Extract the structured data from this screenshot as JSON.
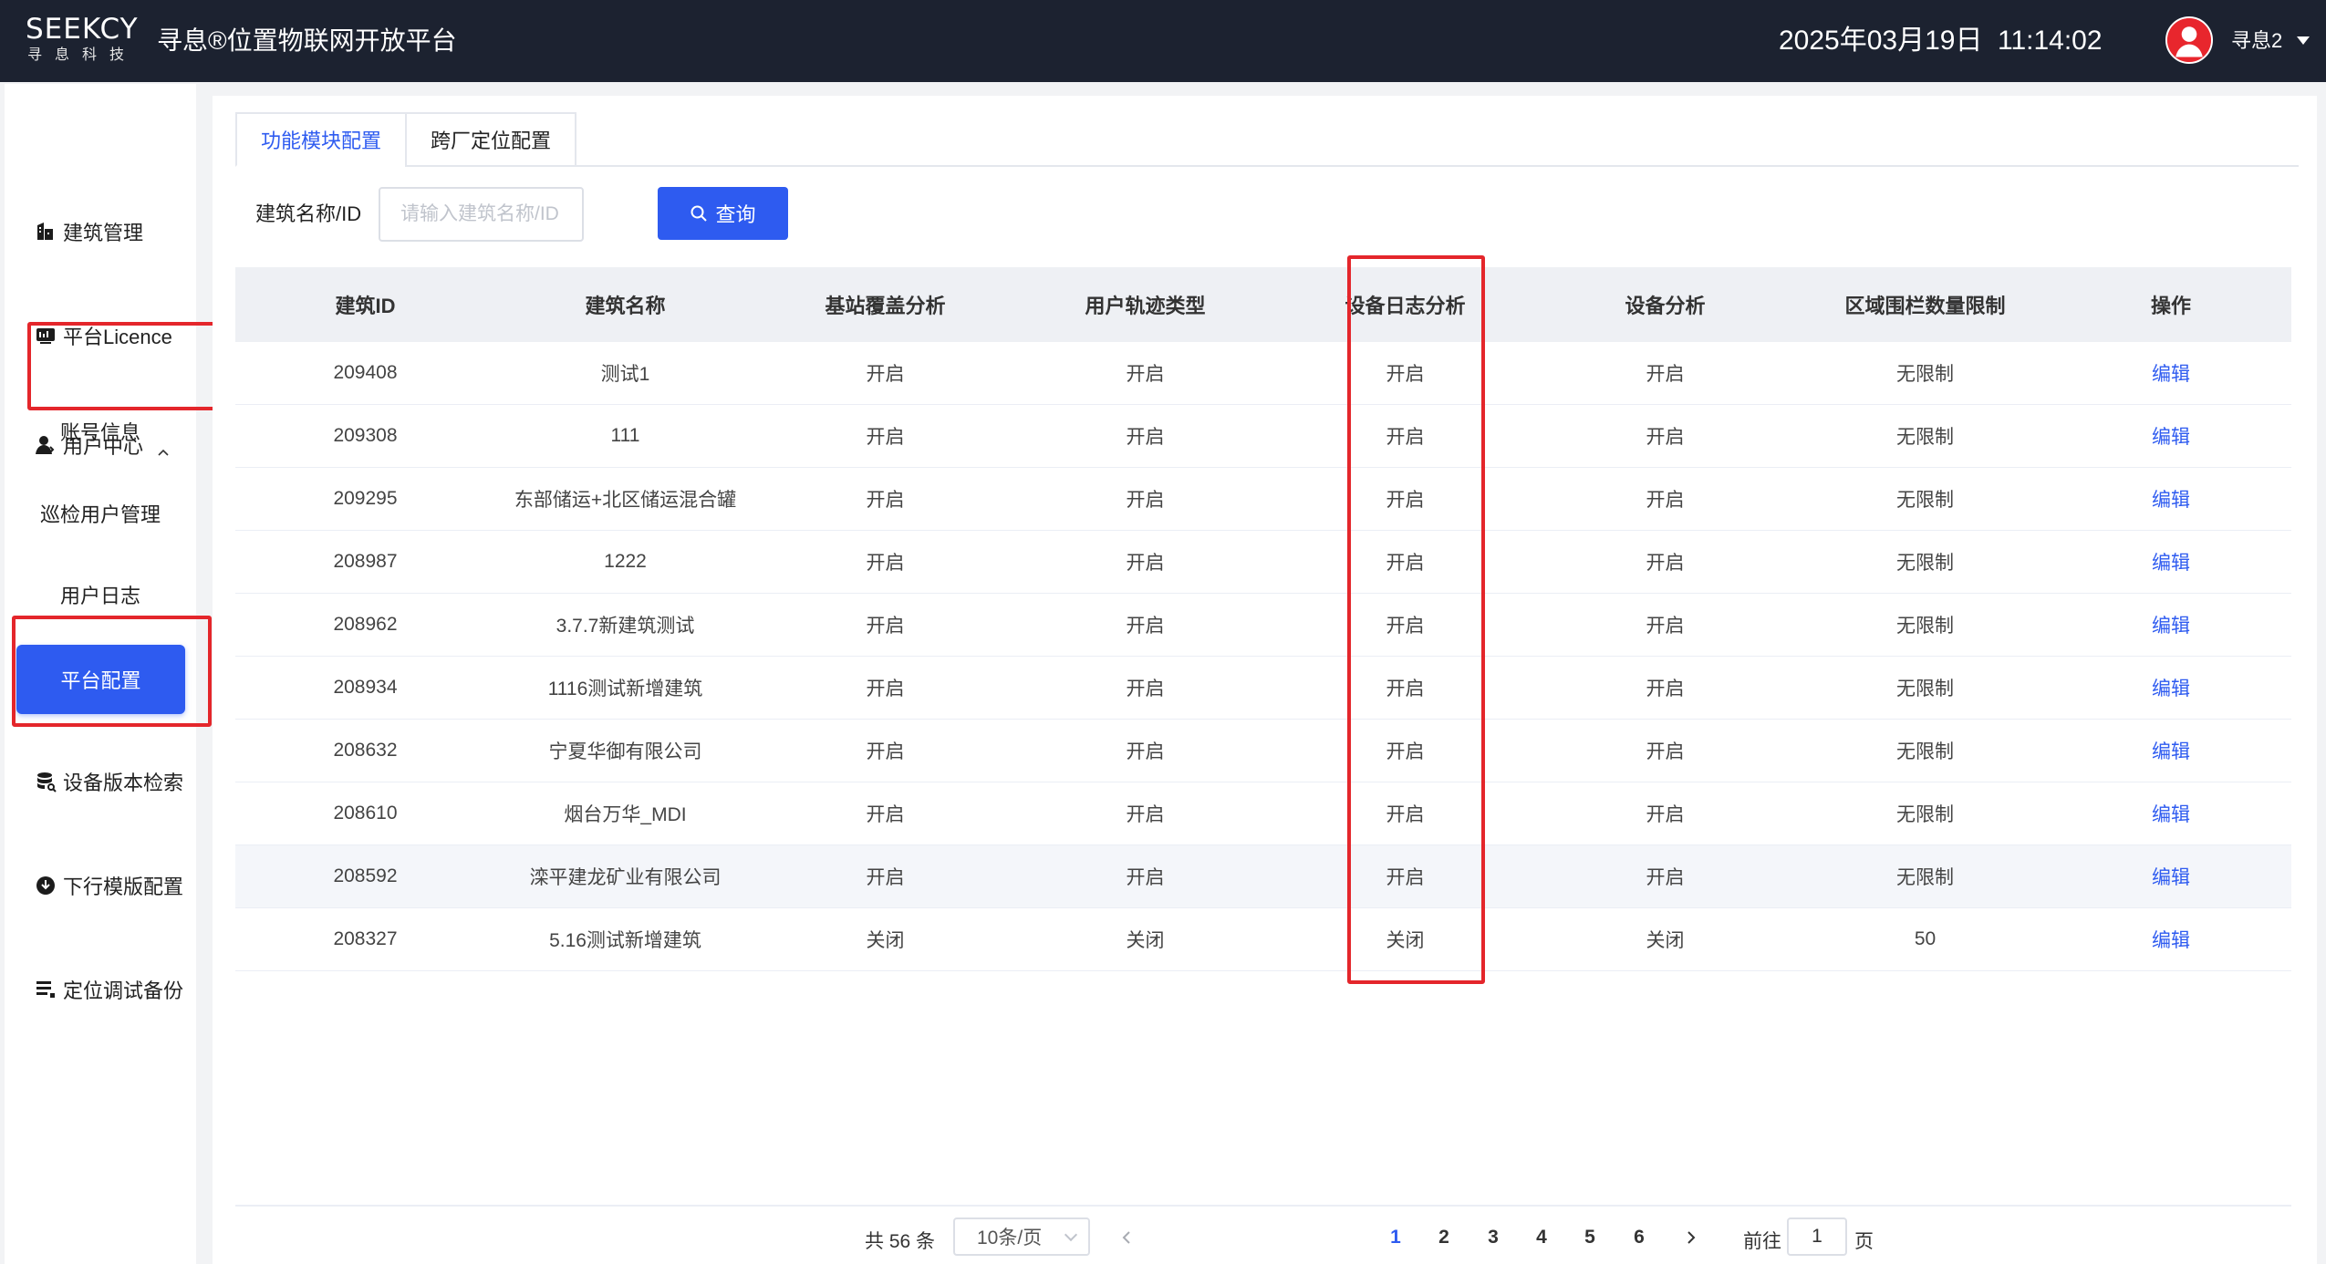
{
  "header": {
    "logo_main": "SEEKCY",
    "logo_sub": "寻息科技",
    "platform_title": "寻息®位置物联网开放平台",
    "date": "2025年03月19日",
    "time": "11:14:02",
    "username": "寻息2"
  },
  "sidebar": {
    "items": [
      {
        "label": "建筑管理",
        "icon": "building-icon"
      },
      {
        "label": "平台Licence",
        "icon": "license-icon"
      },
      {
        "label": "用户中心",
        "icon": "user-center-icon"
      },
      {
        "label": "设备版本检索",
        "icon": "database-icon"
      },
      {
        "label": "下行模版配置",
        "icon": "download-icon"
      },
      {
        "label": "定位调试备份",
        "icon": "list-backup-icon"
      }
    ],
    "sub_items": [
      "账号信息",
      "巡检用户管理",
      "用户日志"
    ],
    "active_item": "平台配置"
  },
  "tabs": [
    {
      "label": "功能模块配置",
      "active": true
    },
    {
      "label": "跨厂定位配置",
      "active": false
    }
  ],
  "search": {
    "label": "建筑名称/ID",
    "placeholder": "请输入建筑名称/ID",
    "button_label": "查询"
  },
  "table": {
    "columns": [
      "建筑ID",
      "建筑名称",
      "基站覆盖分析",
      "用户轨迹类型",
      "设备日志分析",
      "设备分析",
      "区域围栏数量限制",
      "操作"
    ],
    "rows": [
      [
        "209408",
        "测试1",
        "开启",
        "开启",
        "开启",
        "开启",
        "无限制",
        "编辑"
      ],
      [
        "209308",
        "111",
        "开启",
        "开启",
        "开启",
        "开启",
        "无限制",
        "编辑"
      ],
      [
        "209295",
        "东部储运+北区储运混合罐",
        "开启",
        "开启",
        "开启",
        "开启",
        "无限制",
        "编辑"
      ],
      [
        "208987",
        "1222",
        "开启",
        "开启",
        "开启",
        "开启",
        "无限制",
        "编辑"
      ],
      [
        "208962",
        "3.7.7新建筑测试",
        "开启",
        "开启",
        "开启",
        "开启",
        "无限制",
        "编辑"
      ],
      [
        "208934",
        "1116测试新增建筑",
        "开启",
        "开启",
        "开启",
        "开启",
        "无限制",
        "编辑"
      ],
      [
        "208632",
        "宁夏华御有限公司",
        "开启",
        "开启",
        "开启",
        "开启",
        "无限制",
        "编辑"
      ],
      [
        "208610",
        "烟台万华_MDI",
        "开启",
        "开启",
        "开启",
        "开启",
        "无限制",
        "编辑"
      ],
      [
        "208592",
        "滦平建龙矿业有限公司",
        "开启",
        "开启",
        "开启",
        "开启",
        "无限制",
        "编辑"
      ],
      [
        "208327",
        "5.16测试新增建筑",
        "关闭",
        "关闭",
        "关闭",
        "关闭",
        "50",
        "编辑"
      ]
    ]
  },
  "pagination": {
    "total": "共 56 条",
    "page_size": "10条/页",
    "pages": [
      "1",
      "2",
      "3",
      "4",
      "5",
      "6"
    ],
    "current": "1",
    "goto_label": "前往",
    "goto_value": "1",
    "page_suffix": "页"
  },
  "colors": {
    "header_bg": "#1c2230",
    "accent": "#2e5bf0",
    "highlight": "#e4262b",
    "avatar": "#e8262d"
  }
}
